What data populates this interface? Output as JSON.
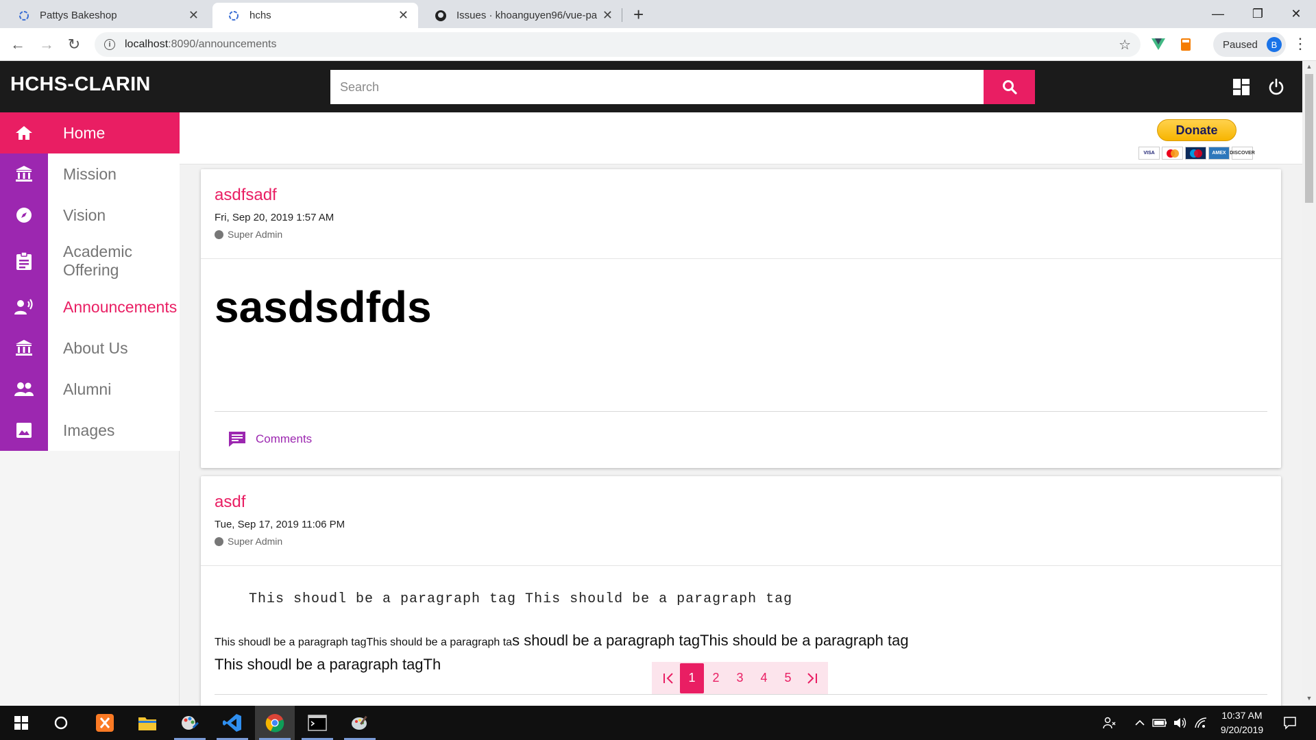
{
  "browser": {
    "tabs": [
      {
        "title": "Pattys Bakeshop",
        "active": false
      },
      {
        "title": "hchs",
        "active": true
      },
      {
        "title": "Issues · khoanguyen96/vue-payp",
        "active": false
      }
    ],
    "url_host": "localhost",
    "url_path": ":8090/announcements",
    "profile_status": "Paused",
    "profile_initial": "B"
  },
  "app": {
    "brand": "HCHS-CLARIN",
    "search_placeholder": "Search",
    "accent": "#e91e63",
    "sidebar_color": "#9c27b0"
  },
  "sidebar": {
    "items": [
      {
        "label": "Home",
        "icon": "home-icon"
      },
      {
        "label": "Mission",
        "icon": "institution-icon"
      },
      {
        "label": "Vision",
        "icon": "compass-icon"
      },
      {
        "label": "Academic Offering",
        "icon": "clipboard-icon"
      },
      {
        "label": "Announcements",
        "icon": "megaphone-icon"
      },
      {
        "label": "About Us",
        "icon": "institution-icon"
      },
      {
        "label": "Alumni",
        "icon": "people-icon"
      },
      {
        "label": "Images",
        "icon": "image-icon"
      }
    ]
  },
  "donate": {
    "label": "Donate",
    "cards": [
      "VISA",
      "MC",
      "MAESTRO",
      "AMEX",
      "DISCOVER"
    ]
  },
  "announcements": [
    {
      "title": "asdfsadf",
      "date": "Fri, Sep 20, 2019 1:57 AM",
      "author": "Super Admin",
      "heading": "sasdsdfds",
      "comments_label": "Comments"
    },
    {
      "title": "asdf",
      "date": "Tue, Sep 17, 2019 11:06 PM",
      "author": "Super Admin",
      "pre": "This shoudl be a paragraph tag This should be a paragraph tag",
      "para_small": "This shoudl be a paragraph tagThis should be a paragraph ta",
      "para_big": "s shoudl be a paragraph tagThis should be a paragraph tag",
      "para_line2": "This shoudl be a paragraph tagTh"
    }
  ],
  "pagination": {
    "pages": [
      "1",
      "2",
      "3",
      "4",
      "5"
    ],
    "current": "1"
  },
  "taskbar": {
    "time": "10:37 AM",
    "date": "9/20/2019"
  }
}
